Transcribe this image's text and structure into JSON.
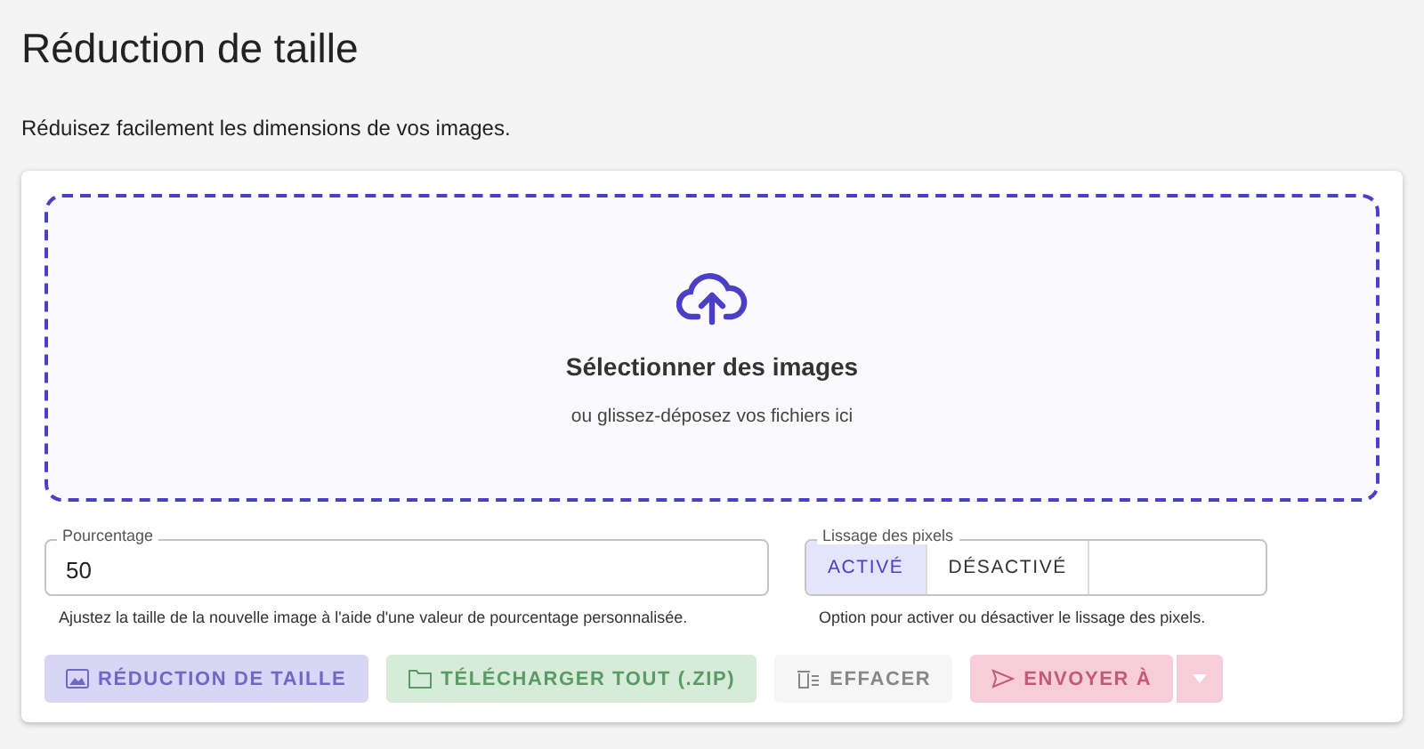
{
  "title": "Réduction de taille",
  "subtitle": "Réduisez facilement les dimensions de vos images.",
  "dropzone": {
    "title": "Sélectionner des images",
    "hint": "ou glissez-déposez vos fichiers ici"
  },
  "percentage": {
    "label": "Pourcentage",
    "value": "50",
    "help": "Ajustez la taille de la nouvelle image à l'aide d'une valeur de pourcentage personnalisée."
  },
  "smoothing": {
    "label": "Lissage des pixels",
    "options": [
      {
        "label": "ACTIVÉ",
        "selected": true
      },
      {
        "label": "DÉSACTIVÉ",
        "selected": false
      }
    ],
    "help": "Option pour activer ou désactiver le lissage des pixels."
  },
  "buttons": [
    {
      "label": "RÉDUCTION DE TAILLE",
      "kind": "resize",
      "disabled": true
    },
    {
      "label": "TÉLÉCHARGER TOUT (.ZIP)",
      "kind": "download",
      "disabled": true
    },
    {
      "label": "EFFACER",
      "kind": "clear",
      "disabled": true
    },
    {
      "label": "ENVOYER À",
      "kind": "send",
      "disabled": true
    }
  ]
}
